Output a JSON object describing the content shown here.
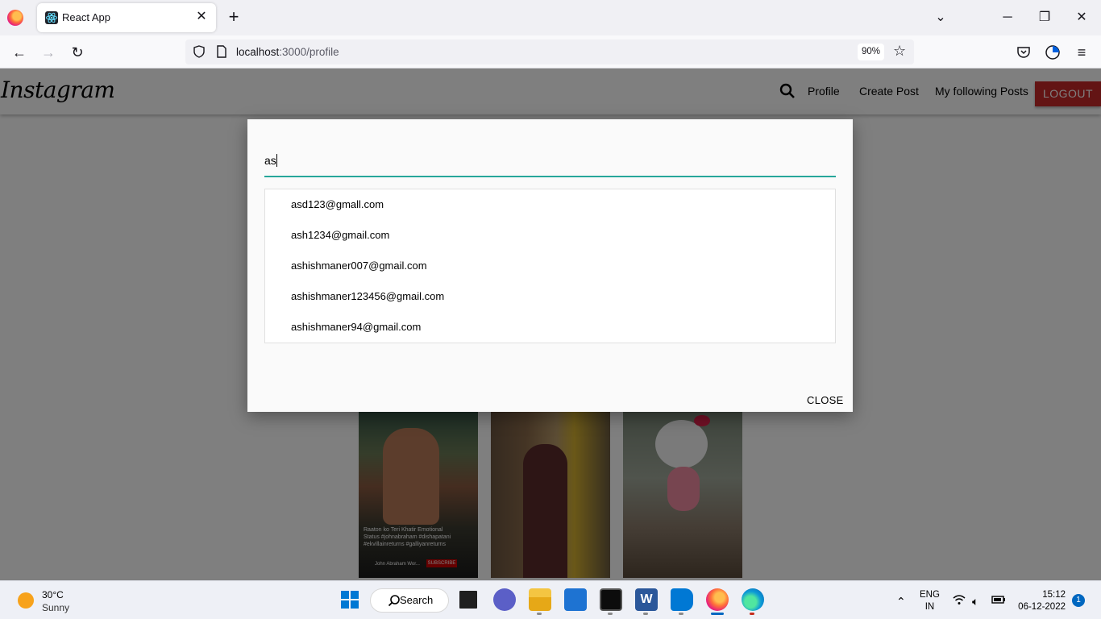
{
  "browser": {
    "tab_title": "React App",
    "tab_close": "✕",
    "new_tab": "+",
    "url_host": "localhost",
    "url_path": ":3000/profile",
    "zoom": "90%"
  },
  "app": {
    "brand": "Instagram",
    "nav": {
      "profile": "Profile",
      "create_post": "Create Post",
      "following": "My following Posts",
      "logout": "LOGOUT"
    }
  },
  "posts": {
    "post1_caption": "Raaton ko Teri Khatir Emotional Status #johnabraham #dishapatani #ekvillainreturns #galliyanreturns",
    "post1_channel": "John Abraham Wor...",
    "post1_subscribe": "SUBSCRIBE"
  },
  "modal": {
    "search_value": "as",
    "results": [
      "asd123@gmall.com",
      "ash1234@gmail.com",
      "ashishmaner007@gmail.com",
      "ashishmaner123456@gmail.com",
      "ashishmaner94@gmail.com"
    ],
    "close": "CLOSE"
  },
  "taskbar": {
    "temperature": "30°C",
    "condition": "Sunny",
    "search": "Search",
    "lang_line1": "ENG",
    "lang_line2": "IN",
    "time": "15:12",
    "date": "06-12-2022",
    "notifications": "1"
  },
  "colors": {
    "accent_underline": "#26a69a",
    "logout_bg": "#c62828"
  }
}
